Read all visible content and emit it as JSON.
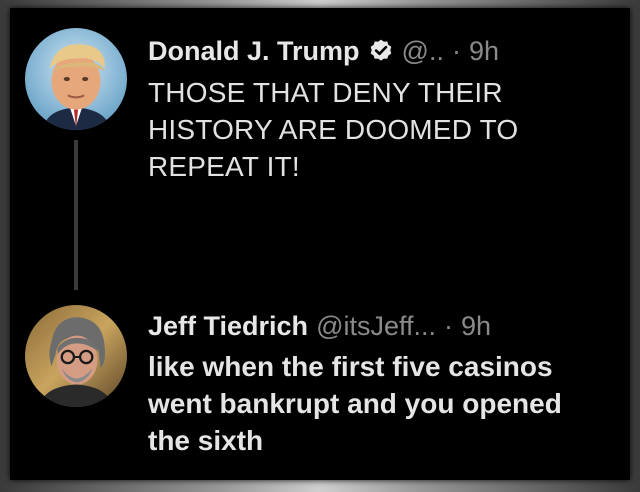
{
  "tweets": [
    {
      "display_name": "Donald J. Trump",
      "verified": true,
      "handle": "@..",
      "separator": "·",
      "time": "9h",
      "text_lines": [
        "THOSE THAT DENY THEIR",
        "HISTORY ARE DOOMED TO",
        "REPEAT IT!"
      ]
    },
    {
      "display_name": "Jeff Tiedrich",
      "verified": false,
      "handle": "@itsJeff...",
      "separator": "·",
      "time": "9h",
      "text_lines": [
        "like when the first five casinos",
        "went bankrupt and you opened",
        "the sixth"
      ]
    }
  ],
  "icons": {
    "verified": "verified-badge-icon"
  },
  "colors": {
    "background": "#000000",
    "primary_text": "#e7e7e7",
    "secondary_text": "#8a8a8a",
    "thread_line": "#3a3a3a"
  }
}
